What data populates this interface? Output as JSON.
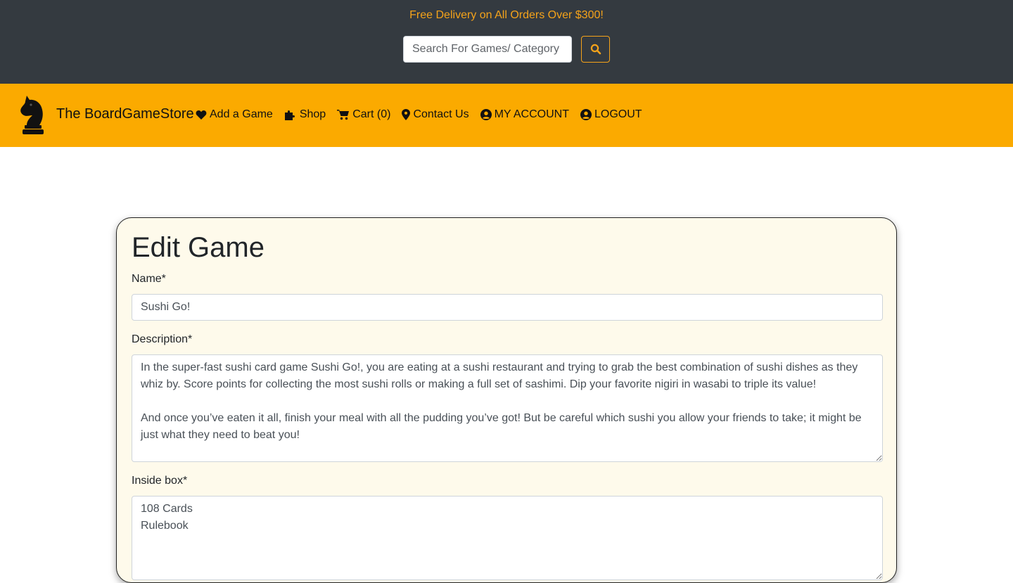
{
  "banner": {
    "promo_text": "Free Delivery on All Orders Over $300!",
    "search_placeholder": "Search For Games/ Category",
    "search_icon": "search-icon",
    "accent_color": "#f5a31a"
  },
  "navbar": {
    "brand": "The BoardGameStore",
    "logo_icon": "chess-knight-icon",
    "background": "#fbaa00",
    "links": [
      {
        "label": "Add a Game",
        "icon": "heart-icon"
      },
      {
        "label": "Shop",
        "icon": "puzzle-icon"
      },
      {
        "label": "Cart (0)",
        "icon": "cart-icon"
      },
      {
        "label": "Contact Us",
        "icon": "map-pin-icon"
      },
      {
        "label": "MY ACCOUNT",
        "icon": "user-circle-icon"
      },
      {
        "label": "LOGOUT",
        "icon": "user-circle-icon"
      }
    ]
  },
  "form": {
    "title": "Edit Game",
    "name_label": "Name*",
    "name_value": "Sushi Go!",
    "description_label": "Description*",
    "description_value": "In the super-fast sushi card game Sushi Go!, you are eating at a sushi restaurant and trying to grab the best combination of sushi dishes as they whiz by. Score points for collecting the most sushi rolls or making a full set of sashimi. Dip your favorite nigiri in wasabi to triple its value!\n\nAnd once you’ve eaten it all, finish your meal with all the pudding you’ve got! But be careful which sushi you allow your friends to take; it might be just what they need to beat you!",
    "inside_box_label": "Inside box*",
    "inside_box_value": "108 Cards\nRulebook"
  }
}
